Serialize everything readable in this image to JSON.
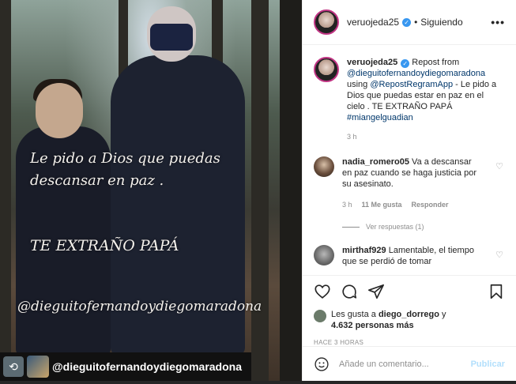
{
  "photo": {
    "overlay_line1": "Le pido a Dios que puedas",
    "overlay_line2": "descansar en paz .",
    "overlay_line3": "TE EXTRAÑO PAPÁ",
    "overlay_handle": "@dieguitofernandoydiegomaradona",
    "strip_handle": "@dieguitofernandoydiegomaradona"
  },
  "header": {
    "username": "veruojeda25",
    "separator": "•",
    "following": "Siguiendo",
    "more": "•••"
  },
  "caption": {
    "username": "veruojeda25",
    "text1": "Repost from",
    "mention1": "@dieguitofernandoydiegomaradona",
    "text2": "using",
    "mention2": "@RepostRegramApp",
    "text3": "- Le pido a Dios que puedas estar en paz en el cielo . TE EXTRAÑO PAPÁ",
    "hashtag": "#miangelguadian",
    "time": "3 h"
  },
  "comments": [
    {
      "username": "nadia_romero05",
      "text": "Va a descansar en paz cuando se haga justicia por su asesinato.",
      "time": "3 h",
      "likes": "11 Me gusta",
      "reply": "Responder",
      "view_replies": "Ver respuestas (1)"
    },
    {
      "username": "mirthaf929",
      "text": "Lamentable, el tiempo que se perdió de tomar"
    }
  ],
  "likes": {
    "prefix": "Les gusta a",
    "user": "diego_dorrego",
    "middle": "y",
    "count": "4.632 personas más"
  },
  "timestamp": "HACE 3 HORAS",
  "add_comment": {
    "placeholder": "Añade un comentario...",
    "publish": "Publicar"
  },
  "colors": {
    "link": "#00376b",
    "verified": "#3897f0",
    "publish_disabled": "#b2dffc"
  }
}
